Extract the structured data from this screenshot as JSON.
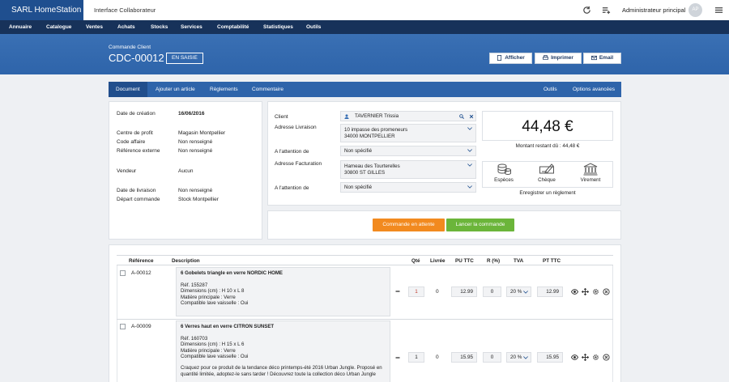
{
  "app": {
    "brand": "SARL HomeStation",
    "subtitle": "Interface Collaborateur",
    "user": "Administrateur principal",
    "avatar": "AP"
  },
  "nav": [
    "Annuaire",
    "Catalogue",
    "Ventes",
    "Achats",
    "Stocks",
    "Services",
    "Comptabilité",
    "Statistiques",
    "Outils"
  ],
  "header": {
    "label": "Commande Client",
    "code": "CDC-00012",
    "status": "EN SAISIE",
    "btn_show": "Afficher",
    "btn_print": "Imprimer",
    "btn_email": "Email"
  },
  "tabs": {
    "document": "Document",
    "add_article": "Ajouter un article",
    "payments": "Règlements",
    "comment": "Commentaire",
    "tools": "Outils",
    "advanced": "Options avancées"
  },
  "info": {
    "creation_label": "Date de création",
    "creation_value": "16/06/2016",
    "profit_label": "Centre de profit",
    "profit_value": "Magasin Montpellier",
    "affaire_label": "Code affaire",
    "affaire_value": "Non renseigné",
    "ref_label": "Référence externe",
    "ref_value": "Non renseigné",
    "seller_label": "Vendeur",
    "seller_value": "Aucun",
    "delivery_label": "Date de livraison",
    "delivery_value": "Non renseigné",
    "depart_label": "Départ commande",
    "depart_value": "Stock Montpellier"
  },
  "client": {
    "client_label": "Client",
    "client_value": "TAVERNIER Trissia",
    "delivery_label": "Adresse Livraison",
    "delivery_line1": "10 impasse des promeneurs",
    "delivery_line2": "34000 MONTPELLIER",
    "attn_label": "A l'attention de",
    "attn_value": "Non spécifié",
    "billing_label": "Adresse Facturation",
    "billing_line1": "Hameau des Tourterelles",
    "billing_line2": "30800 ST GILLES",
    "attn2_label": "A l'attention de",
    "attn2_value": "Non spécifié"
  },
  "summary": {
    "amount": "44,48  €",
    "remaining": "Montant restant dû : 44,48  €",
    "cash": "Espèces",
    "cheque": "Chèque",
    "transfer": "Virement",
    "register": "Enregistrer un règlement"
  },
  "actions": {
    "pending": "Commande en attente",
    "launch": "Lancer la commande"
  },
  "table": {
    "headers": {
      "ref": "Référence",
      "desc": "Description",
      "qty": "Qté",
      "delivered": "Livrée",
      "pu": "PU TTC",
      "discount": "R (%)",
      "tva": "TVA",
      "pt": "PT TTC"
    },
    "rows": [
      {
        "ref": "A-00012",
        "title": "6 Gobelets triangle en verre NORDIC HOME",
        "l1": "Réf. 155287",
        "l2": "Dimensions (cm) : H 10 x L 8",
        "l3": "Matière principale : Verre",
        "l4": "Compatible lave vaisselle : Oui",
        "l5": "",
        "l6": "",
        "l7": "",
        "qty": "1",
        "delivered": "0",
        "pu": "12.99",
        "discount": "0",
        "tva": "20 %",
        "pt": "12.99"
      },
      {
        "ref": "A-00009",
        "title": "6 Verres haut en verre CITRON SUNSET",
        "l1": "Réf. 160703",
        "l2": "Dimensions (cm) : H 15 x L 6",
        "l3": "Matière principale : Verre",
        "l4": "Compatible lave vaisselle : Oui",
        "l5": "Craquez pour ce produit de la tendance déco printemps-été 2016 Urban Jungle. Proposé en",
        "l6": "quantité limitée, adoptez-le sans tarder ! Découvrez toute la collection déco Urban Jungle",
        "l7": "",
        "qty": "1",
        "delivered": "0",
        "pu": "15.95",
        "discount": "0",
        "tva": "20 %",
        "pt": "15.95"
      }
    ]
  },
  "colors": {
    "brand": "#1f4f8f",
    "nav": "#17325a",
    "hero": "#2e64aa",
    "orange": "#f28a1f",
    "green": "#6bb53a"
  }
}
